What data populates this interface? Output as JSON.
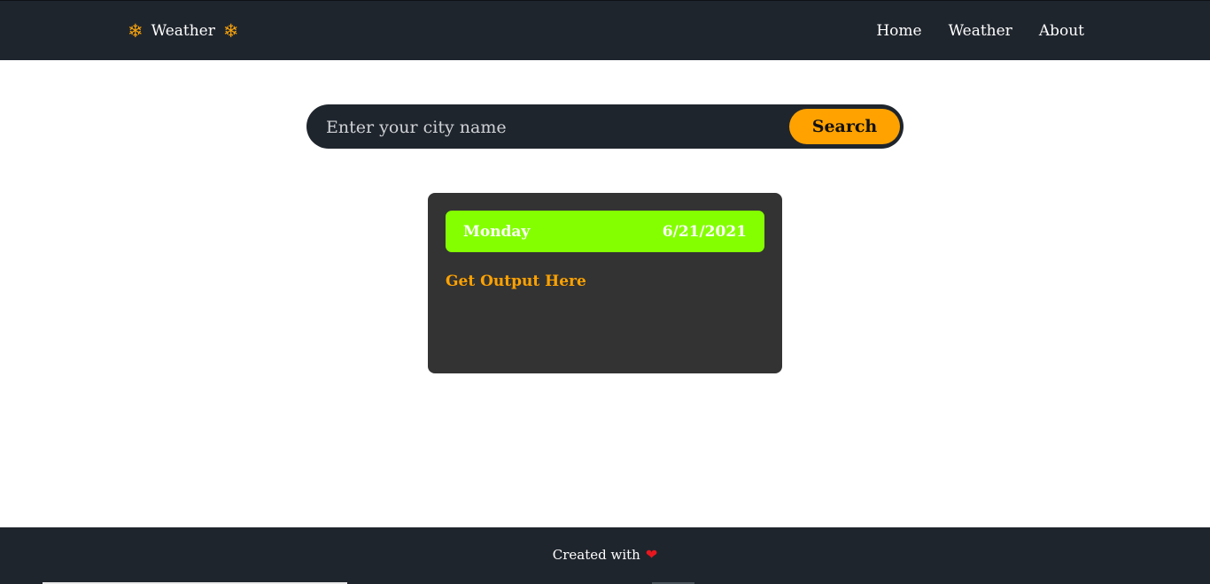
{
  "navbar": {
    "brand": {
      "icon_left": "❄",
      "title": "Weather",
      "icon_right": "❄",
      "icon_name": "snowflake-icon",
      "icon_color": "#f5a10c"
    },
    "links": [
      {
        "label": "Home"
      },
      {
        "label": "Weather"
      },
      {
        "label": "About"
      }
    ]
  },
  "search": {
    "placeholder": "Enter your city name",
    "value": "",
    "button_label": "Search",
    "button_color": "#ffa200"
  },
  "card": {
    "day": "Monday",
    "date": "6/21/2021",
    "output_text": "Get Output Here",
    "header_color": "#84ff00",
    "output_color": "#ffa200"
  },
  "footer": {
    "text": "Created with",
    "heart_icon": "❤",
    "icon_name": "heart-icon",
    "heart_color": "#e8171f"
  },
  "colors": {
    "dark": "#1f252d",
    "card_bg": "#333333"
  }
}
